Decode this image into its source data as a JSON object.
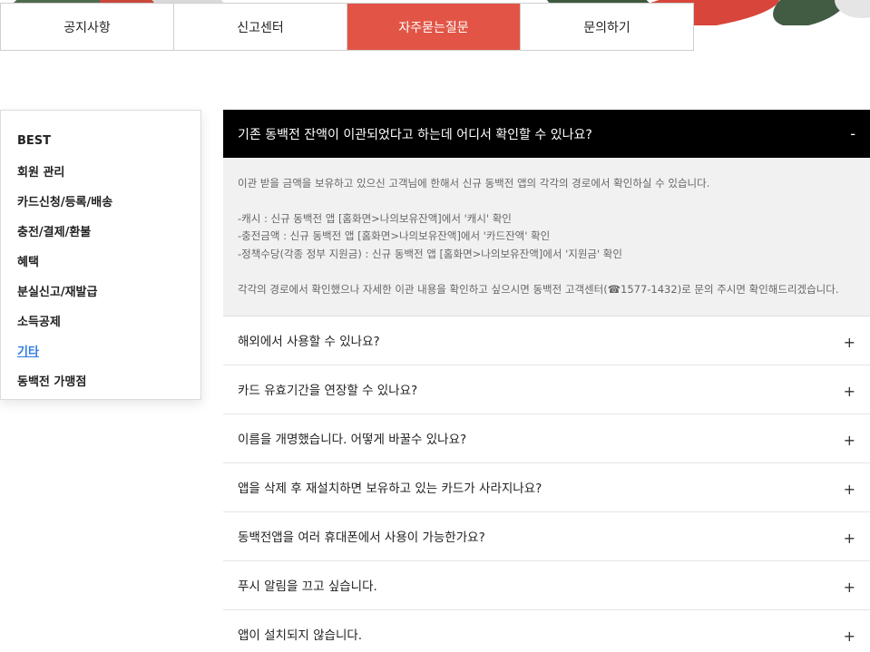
{
  "tabs": [
    {
      "label": "공지사항",
      "active": false
    },
    {
      "label": "신고센터",
      "active": false
    },
    {
      "label": "자주묻는질문",
      "active": true
    },
    {
      "label": "문의하기",
      "active": false
    }
  ],
  "sidebar": {
    "items": [
      {
        "label": "BEST",
        "active": false
      },
      {
        "label": "회원 관리",
        "active": false
      },
      {
        "label": "카드신청/등록/배송",
        "active": false
      },
      {
        "label": "충전/결제/환불",
        "active": false
      },
      {
        "label": "혜택",
        "active": false
      },
      {
        "label": "분실신고/재발급",
        "active": false
      },
      {
        "label": "소득공제",
        "active": false
      },
      {
        "label": "기타",
        "active": true
      },
      {
        "label": "동백전 가맹점",
        "active": false
      }
    ]
  },
  "faq": {
    "open": {
      "question": "기존 동백전 잔액이 이관되었다고 하는데 어디서 확인할 수 있나요?",
      "toggle": "-",
      "answer": {
        "intro": "이관 받을 금액을 보유하고 있으신 고객님에 한해서 신규 동백전 앱의 각각의 경로에서 확인하실 수 있습니다.",
        "lines": [
          "-캐시 : 신규 동백전 앱 [홈화면>나의보유잔액]에서 '캐시' 확인",
          "-충전금액 : 신규 동백전 앱 [홈화면>나의보유잔액]에서 '카드잔액' 확인",
          "-정책수당(각종 정부 지원금) : 신규 동백전 앱 [홈화면>나의보유잔액]에서 '지원금' 확인"
        ],
        "outro": "각각의 경로에서 확인했으나 자세한 이관 내용을 확인하고 싶으시면 동백전 고객센터(☎1577-1432)로 문의 주시면 확인해드리겠습니다."
      }
    },
    "items": [
      {
        "question": "해외에서 사용할 수 있나요?",
        "toggle": "+"
      },
      {
        "question": "카드 유효기간을 연장할 수 있나요?",
        "toggle": "+"
      },
      {
        "question": "이름을 개명했습니다. 어떻게 바꿀수 있나요?",
        "toggle": "+"
      },
      {
        "question": "앱을 삭제 후 재설치하면 보유하고 있는 카드가 사라지나요?",
        "toggle": "+"
      },
      {
        "question": "동백전앱을 여러 휴대폰에서 사용이 가능한가요?",
        "toggle": "+"
      },
      {
        "question": "푸시 알림을 끄고 싶습니다.",
        "toggle": "+"
      },
      {
        "question": "앱이 설치되지 않습니다.",
        "toggle": "+"
      }
    ]
  },
  "colors": {
    "accent": "#e25546",
    "active_link": "#2e7be0",
    "open_question_bg": "#000000",
    "answer_bg": "#f1f1f1"
  }
}
